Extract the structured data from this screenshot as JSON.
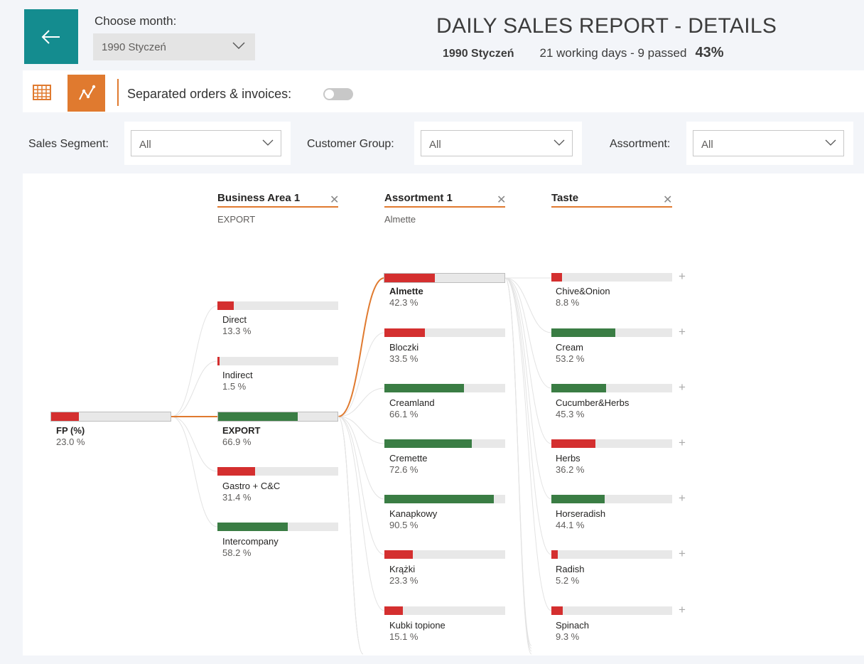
{
  "header": {
    "month_label": "Choose month:",
    "month_value": "1990 Styczeń",
    "title": "DAILY SALES REPORT - DETAILS",
    "subtitle_month": "1990 Styczeń",
    "working_days": "21 working days - 9 passed",
    "progress_pct": "43%"
  },
  "toolbar": {
    "separated_label": "Separated orders & invoices:",
    "separated_on": false
  },
  "filters": [
    {
      "label": "Sales Segment:",
      "value": "All"
    },
    {
      "label": "Customer Group:",
      "value": "All"
    },
    {
      "label": "Assortment:",
      "value": "All"
    }
  ],
  "colors": {
    "accent": "#e07a2f",
    "teal": "#148c8f",
    "bar_bad": "#d42f2f",
    "bar_good": "#3a7d44",
    "bar_track": "#e8e8e8"
  },
  "tree": {
    "root": {
      "label": "FP (%)",
      "value": "23.0 %",
      "fraction": 0.23,
      "color": "red"
    },
    "columns": [
      {
        "header": "Business Area 1",
        "selection": "EXPORT",
        "nodes": [
          {
            "label": "Direct",
            "value": "13.3 %",
            "fraction": 0.133,
            "color": "red"
          },
          {
            "label": "Indirect",
            "value": "1.5 %",
            "fraction": 0.015,
            "color": "red"
          },
          {
            "label": "EXPORT",
            "value": "66.9 %",
            "fraction": 0.669,
            "color": "green",
            "selected": true
          },
          {
            "label": "Gastro + C&C",
            "value": "31.4 %",
            "fraction": 0.314,
            "color": "red"
          },
          {
            "label": "Intercompany",
            "value": "58.2 %",
            "fraction": 0.582,
            "color": "green"
          }
        ]
      },
      {
        "header": "Assortment 1",
        "selection": "Almette",
        "nodes": [
          {
            "label": "Almette",
            "value": "42.3 %",
            "fraction": 0.423,
            "color": "red",
            "selected": true
          },
          {
            "label": "Bloczki",
            "value": "33.5 %",
            "fraction": 0.335,
            "color": "red"
          },
          {
            "label": "Creamland",
            "value": "66.1 %",
            "fraction": 0.661,
            "color": "green"
          },
          {
            "label": "Cremette",
            "value": "72.6 %",
            "fraction": 0.726,
            "color": "green"
          },
          {
            "label": "Kanapkowy",
            "value": "90.5 %",
            "fraction": 0.905,
            "color": "green"
          },
          {
            "label": "Krążki",
            "value": "23.3 %",
            "fraction": 0.233,
            "color": "red"
          },
          {
            "label": "Kubki topione",
            "value": "15.1 %",
            "fraction": 0.151,
            "color": "red"
          }
        ]
      },
      {
        "header": "Taste",
        "selection": "",
        "nodes": [
          {
            "label": "Chive&Onion",
            "value": "8.8 %",
            "fraction": 0.088,
            "color": "red"
          },
          {
            "label": "Cream",
            "value": "53.2 %",
            "fraction": 0.532,
            "color": "green"
          },
          {
            "label": "Cucumber&Herbs",
            "value": "45.3 %",
            "fraction": 0.453,
            "color": "green"
          },
          {
            "label": "Herbs",
            "value": "36.2 %",
            "fraction": 0.362,
            "color": "red"
          },
          {
            "label": "Horseradish",
            "value": "44.1 %",
            "fraction": 0.441,
            "color": "green"
          },
          {
            "label": "Radish",
            "value": "5.2 %",
            "fraction": 0.052,
            "color": "red"
          },
          {
            "label": "Spinach",
            "value": "9.3 %",
            "fraction": 0.093,
            "color": "red"
          }
        ]
      }
    ]
  }
}
